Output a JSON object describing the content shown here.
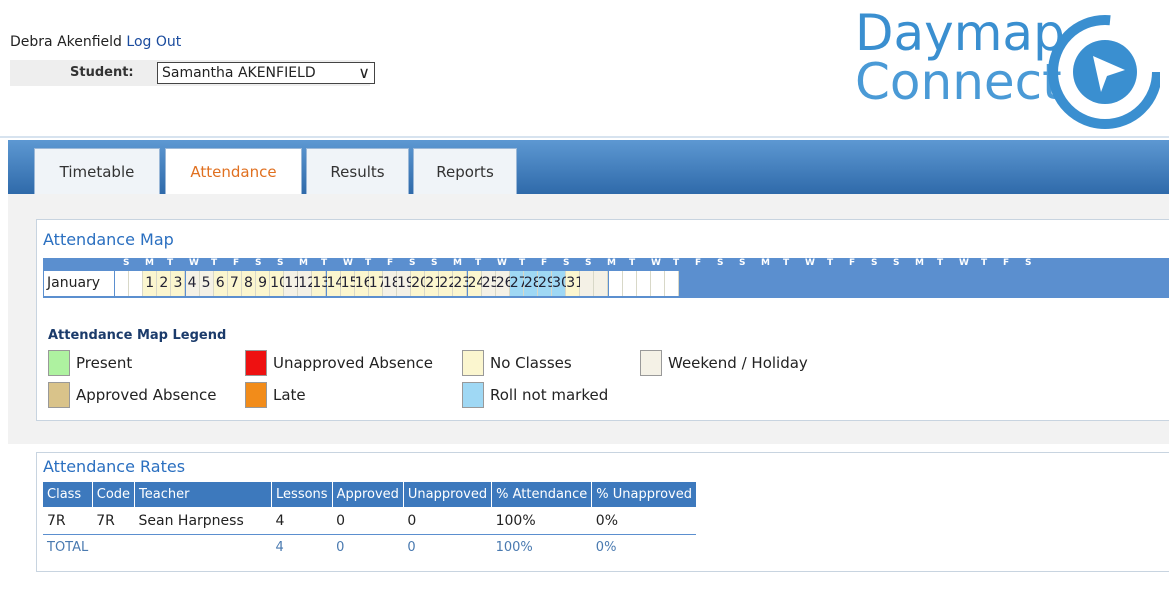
{
  "header": {
    "user_name": "Debra Akenfield",
    "logout_label": "Log Out",
    "student_label": "Student:",
    "student_value": "Samantha AKENFIELD"
  },
  "logo": {
    "line1": "Daymap",
    "line2": "Connect",
    "brand_color": "#3a8fd0"
  },
  "tabs": [
    {
      "label": "Timetable",
      "active": false
    },
    {
      "label": "Attendance",
      "active": true
    },
    {
      "label": "Results",
      "active": false
    },
    {
      "label": "Reports",
      "active": false
    }
  ],
  "attendance_map": {
    "title": "Attendance Map",
    "month": "January",
    "dow_header": [
      "S",
      "M",
      "T",
      "W",
      "T",
      "F",
      "S",
      "S",
      "M",
      "T",
      "W",
      "T",
      "F",
      "S",
      "S",
      "M",
      "T",
      "W",
      "T",
      "F",
      "S",
      "S",
      "M",
      "T",
      "W",
      "T",
      "F",
      "S",
      "S",
      "M",
      "T",
      "W",
      "T",
      "F",
      "S",
      "S",
      "M",
      "T",
      "W",
      "T",
      "F",
      "S"
    ],
    "days": [
      {
        "label": "",
        "status": "blank"
      },
      {
        "label": "",
        "status": "blank"
      },
      {
        "label": "1",
        "status": "no-classes"
      },
      {
        "label": "2",
        "status": "no-classes"
      },
      {
        "label": "3",
        "status": "no-classes"
      },
      {
        "label": "4",
        "status": "weekend"
      },
      {
        "label": "5",
        "status": "weekend"
      },
      {
        "label": "6",
        "status": "no-classes"
      },
      {
        "label": "7",
        "status": "no-classes"
      },
      {
        "label": "8",
        "status": "no-classes"
      },
      {
        "label": "9",
        "status": "no-classes"
      },
      {
        "label": "10",
        "status": "no-classes"
      },
      {
        "label": "11",
        "status": "weekend"
      },
      {
        "label": "12",
        "status": "weekend"
      },
      {
        "label": "13",
        "status": "no-classes"
      },
      {
        "label": "14",
        "status": "no-classes"
      },
      {
        "label": "15",
        "status": "no-classes"
      },
      {
        "label": "16",
        "status": "no-classes"
      },
      {
        "label": "17",
        "status": "no-classes"
      },
      {
        "label": "18",
        "status": "weekend"
      },
      {
        "label": "19",
        "status": "weekend"
      },
      {
        "label": "20",
        "status": "no-classes"
      },
      {
        "label": "21",
        "status": "no-classes"
      },
      {
        "label": "22",
        "status": "no-classes"
      },
      {
        "label": "23",
        "status": "no-classes"
      },
      {
        "label": "24",
        "status": "no-classes"
      },
      {
        "label": "25",
        "status": "weekend"
      },
      {
        "label": "26",
        "status": "weekend"
      },
      {
        "label": "27",
        "status": "roll-not-marked"
      },
      {
        "label": "28",
        "status": "roll-not-marked"
      },
      {
        "label": "29",
        "status": "roll-not-marked"
      },
      {
        "label": "30",
        "status": "roll-not-marked"
      },
      {
        "label": "31",
        "status": "no-classes"
      },
      {
        "label": "",
        "status": "weekend"
      },
      {
        "label": "",
        "status": "weekend"
      },
      {
        "label": "",
        "status": "blank"
      },
      {
        "label": "",
        "status": "blank"
      },
      {
        "label": "",
        "status": "blank"
      },
      {
        "label": "",
        "status": "blank"
      },
      {
        "label": "",
        "status": "blank"
      }
    ],
    "legend_title": "Attendance Map Legend",
    "legend": [
      {
        "label": "Present",
        "color": "#aef2a0"
      },
      {
        "label": "Unapproved Absence",
        "color": "#ee1111"
      },
      {
        "label": "No Classes",
        "color": "#fbf6cf"
      },
      {
        "label": "Weekend / Holiday",
        "color": "#f4f1e6"
      },
      {
        "label": "Approved Absence",
        "color": "#d9c38a"
      },
      {
        "label": "Late",
        "color": "#f28c1a"
      },
      {
        "label": "Roll not marked",
        "color": "#9fd8f4"
      }
    ]
  },
  "attendance_rates": {
    "title": "Attendance Rates",
    "columns": [
      "Class",
      "Code",
      "Teacher",
      "Lessons",
      "Approved",
      "Unapproved",
      "% Attendance",
      "% Unapproved"
    ],
    "rows": [
      [
        "7R",
        "7R",
        "Sean Harpness",
        "4",
        "0",
        "0",
        "100%",
        "0%"
      ]
    ],
    "total": [
      "TOTAL",
      "",
      "",
      "4",
      "0",
      "0",
      "100%",
      "0%"
    ]
  }
}
